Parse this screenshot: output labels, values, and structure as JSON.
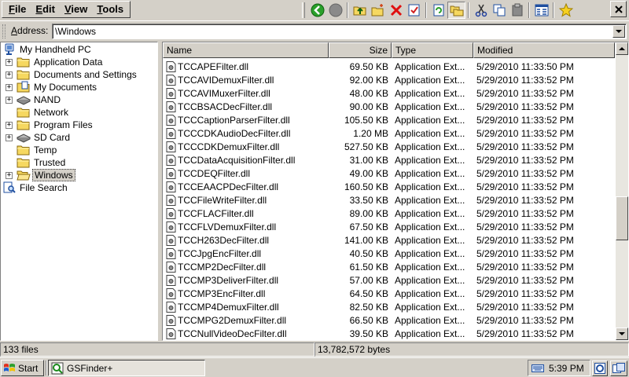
{
  "menu": {
    "items": [
      {
        "name": "menu-file",
        "underline": "F",
        "rest": "ile"
      },
      {
        "name": "menu-edit",
        "underline": "E",
        "rest": "dit"
      },
      {
        "name": "menu-view",
        "underline": "V",
        "rest": "iew"
      },
      {
        "name": "menu-tools",
        "underline": "T",
        "rest": "ools"
      }
    ]
  },
  "toolbar": {
    "icons": [
      "back-icon",
      "stop-icon",
      "up-folder-icon",
      "new-folder-icon",
      "delete-icon",
      "properties-icon",
      "refresh-icon",
      "folders-icon",
      "cut-icon",
      "copy-icon",
      "paste-icon",
      "view-icon",
      "favorites-icon"
    ],
    "pressed": "folders-icon",
    "close_icon": "close-icon"
  },
  "address": {
    "label_underline": "A",
    "label_rest": "ddress:",
    "value": "\\Windows"
  },
  "tree": {
    "items": [
      {
        "label": "My Handheld PC",
        "icon": "handheld-pc-icon",
        "indent": 0,
        "expander": false
      },
      {
        "label": "Application Data",
        "icon": "folder-icon",
        "indent": 1,
        "expander": true
      },
      {
        "label": "Documents and Settings",
        "icon": "folder-icon",
        "indent": 1,
        "expander": true
      },
      {
        "label": "My Documents",
        "icon": "my-documents-icon",
        "indent": 1,
        "expander": true
      },
      {
        "label": "NAND",
        "icon": "storage-card-icon",
        "indent": 1,
        "expander": true
      },
      {
        "label": "Network",
        "icon": "folder-icon",
        "indent": 1,
        "expander": false
      },
      {
        "label": "Program Files",
        "icon": "folder-icon",
        "indent": 1,
        "expander": true
      },
      {
        "label": "SD Card",
        "icon": "storage-card-icon",
        "indent": 1,
        "expander": true
      },
      {
        "label": "Temp",
        "icon": "folder-icon",
        "indent": 1,
        "expander": false
      },
      {
        "label": "Trusted",
        "icon": "folder-icon",
        "indent": 1,
        "expander": false
      },
      {
        "label": "Windows",
        "icon": "open-folder-icon",
        "indent": 1,
        "expander": true,
        "selected": true
      },
      {
        "label": "File Search",
        "icon": "file-search-icon",
        "indent": 0,
        "expander": false
      }
    ]
  },
  "list": {
    "columns": [
      "Name",
      "Size",
      "Type",
      "Modified"
    ],
    "rows": [
      {
        "name": "TCCAPEFilter.dll",
        "size": "69.50 KB",
        "type": "Application Ext...",
        "modified": "5/29/2010 11:33:50 PM"
      },
      {
        "name": "TCCAVIDemuxFilter.dll",
        "size": "92.00 KB",
        "type": "Application Ext...",
        "modified": "5/29/2010 11:33:52 PM"
      },
      {
        "name": "TCCAVIMuxerFilter.dll",
        "size": "48.00 KB",
        "type": "Application Ext...",
        "modified": "5/29/2010 11:33:52 PM"
      },
      {
        "name": "TCCBSACDecFilter.dll",
        "size": "90.00 KB",
        "type": "Application Ext...",
        "modified": "5/29/2010 11:33:52 PM"
      },
      {
        "name": "TCCCaptionParserFilter.dll",
        "size": "105.50 KB",
        "type": "Application Ext...",
        "modified": "5/29/2010 11:33:52 PM"
      },
      {
        "name": "TCCCDKAudioDecFilter.dll",
        "size": "1.20 MB",
        "type": "Application Ext...",
        "modified": "5/29/2010 11:33:52 PM"
      },
      {
        "name": "TCCCDKDemuxFilter.dll",
        "size": "527.50 KB",
        "type": "Application Ext...",
        "modified": "5/29/2010 11:33:52 PM"
      },
      {
        "name": "TCCDataAcquisitionFilter.dll",
        "size": "31.00 KB",
        "type": "Application Ext...",
        "modified": "5/29/2010 11:33:52 PM"
      },
      {
        "name": "TCCDEQFilter.dll",
        "size": "49.00 KB",
        "type": "Application Ext...",
        "modified": "5/29/2010 11:33:52 PM"
      },
      {
        "name": "TCCEAACPDecFilter.dll",
        "size": "160.50 KB",
        "type": "Application Ext...",
        "modified": "5/29/2010 11:33:52 PM"
      },
      {
        "name": "TCCFileWriteFilter.dll",
        "size": "33.50 KB",
        "type": "Application Ext...",
        "modified": "5/29/2010 11:33:52 PM"
      },
      {
        "name": "TCCFLACFilter.dll",
        "size": "89.00 KB",
        "type": "Application Ext...",
        "modified": "5/29/2010 11:33:52 PM"
      },
      {
        "name": "TCCFLVDemuxFilter.dll",
        "size": "67.50 KB",
        "type": "Application Ext...",
        "modified": "5/29/2010 11:33:52 PM"
      },
      {
        "name": "TCCH263DecFilter.dll",
        "size": "141.00 KB",
        "type": "Application Ext...",
        "modified": "5/29/2010 11:33:52 PM"
      },
      {
        "name": "TCCJpgEncFilter.dll",
        "size": "40.50 KB",
        "type": "Application Ext...",
        "modified": "5/29/2010 11:33:52 PM"
      },
      {
        "name": "TCCMP2DecFilter.dll",
        "size": "61.50 KB",
        "type": "Application Ext...",
        "modified": "5/29/2010 11:33:52 PM"
      },
      {
        "name": "TCCMP3DeliverFilter.dll",
        "size": "57.00 KB",
        "type": "Application Ext...",
        "modified": "5/29/2010 11:33:52 PM"
      },
      {
        "name": "TCCMP3EncFilter.dll",
        "size": "64.50 KB",
        "type": "Application Ext...",
        "modified": "5/29/2010 11:33:52 PM"
      },
      {
        "name": "TCCMP4DemuxFilter.dll",
        "size": "82.50 KB",
        "type": "Application Ext...",
        "modified": "5/29/2010 11:33:52 PM"
      },
      {
        "name": "TCCMPG2DemuxFilter.dll",
        "size": "66.50 KB",
        "type": "Application Ext...",
        "modified": "5/29/2010 11:33:52 PM"
      },
      {
        "name": "TCCNullVideoDecFilter.dll",
        "size": "39.50 KB",
        "type": "Application Ext...",
        "modified": "5/29/2010 11:33:52 PM"
      }
    ],
    "scroll_position": 0.62,
    "scroll_visible_fraction": 0.16
  },
  "status": {
    "file_count": "133 files",
    "total_size": "13,782,572 bytes"
  },
  "taskbar": {
    "start_label": "Start",
    "app_label": "GSFinder+",
    "clock": "5:39 PM"
  },
  "colors": {
    "window_face": "#d4d0c8",
    "folder_yellow": "#f6d860",
    "highlight_gray": "#d4d0c8"
  }
}
